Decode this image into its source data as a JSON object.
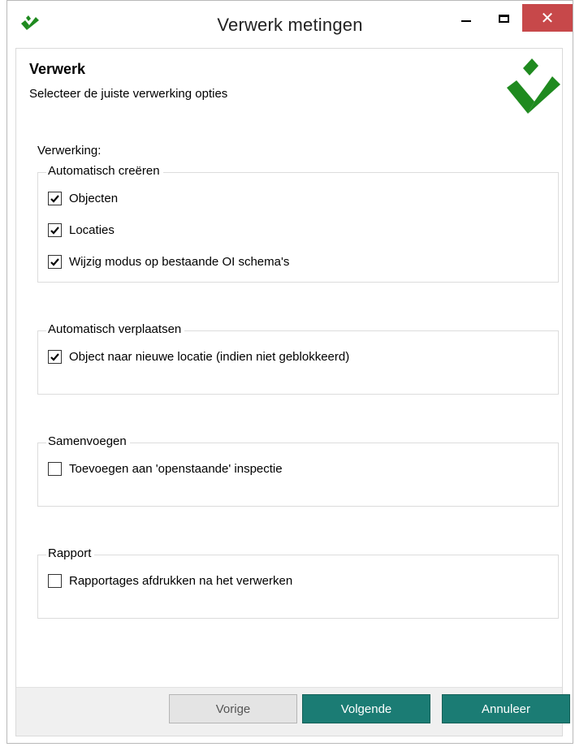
{
  "window": {
    "title": "Verwerk metingen",
    "close_glyph": "✕",
    "icon": "checkmark-logo-icon"
  },
  "header": {
    "heading": "Verwerk",
    "subheading": "Selecteer de juiste verwerking opties"
  },
  "section_label": "Verwerking:",
  "groups": [
    {
      "legend": "Automatisch creëren",
      "options": [
        {
          "label": "Objecten",
          "checked": true
        },
        {
          "label": "Locaties",
          "checked": true
        },
        {
          "label": "Wijzig modus op bestaande OI schema's",
          "checked": true
        }
      ]
    },
    {
      "legend": "Automatisch verplaatsen",
      "options": [
        {
          "label": "Object naar nieuwe locatie (indien niet geblokkeerd)",
          "checked": true
        }
      ]
    },
    {
      "legend": "Samenvoegen",
      "options": [
        {
          "label": "Toevoegen aan 'openstaande' inspectie",
          "checked": false
        }
      ]
    },
    {
      "legend": "Rapport",
      "options": [
        {
          "label": "Rapportages afdrukken na het verwerken",
          "checked": false
        }
      ]
    }
  ],
  "buttons": {
    "back": "Vorige",
    "next": "Volgende",
    "cancel": "Annuleer"
  },
  "colors": {
    "accent": "#1b7c74",
    "logo_green": "#1f8a1f",
    "close_red": "#c7484a"
  }
}
